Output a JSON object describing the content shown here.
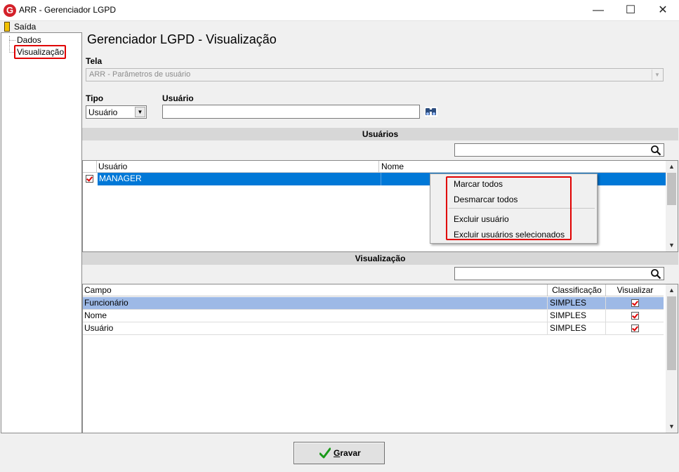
{
  "window": {
    "title": "ARR - Gerenciador LGPD",
    "app_icon_letter": "G",
    "min_glyph": "—",
    "max_glyph": "☐",
    "close_glyph": "✕"
  },
  "menubar": {
    "saida_label": "Saída"
  },
  "tree": {
    "items": [
      {
        "label": "Dados"
      },
      {
        "label": "Visualização",
        "highlighted": true
      }
    ]
  },
  "main": {
    "title": "Gerenciador LGPD - Visualização",
    "tela_label": "Tela",
    "tela_value": "ARR - Parâmetros de usuário",
    "tipo_label": "Tipo",
    "tipo_value": "Usuário",
    "usuario_label": "Usuário",
    "usuario_value": ""
  },
  "usuarios_section": {
    "title": "Usuários",
    "search_value": "",
    "columns": [
      "Usuário",
      "Nome"
    ],
    "rows": [
      {
        "checked": true,
        "usuario": "MANAGER",
        "nome": "",
        "selected": true
      }
    ]
  },
  "context_menu": {
    "items": [
      {
        "label": "Marcar todos"
      },
      {
        "label": "Desmarcar todos"
      },
      {
        "label": "Excluir usuário"
      },
      {
        "label": "Excluir usuários selecionados"
      }
    ]
  },
  "visualizacao_section": {
    "title": "Visualização",
    "search_value": "",
    "columns": [
      "Campo",
      "Classificação",
      "Visualizar"
    ],
    "rows": [
      {
        "campo": "Funcionário",
        "classificacao": "SIMPLES",
        "visualizar": true,
        "selected": true
      },
      {
        "campo": "Nome",
        "classificacao": "SIMPLES",
        "visualizar": true,
        "selected": false
      },
      {
        "campo": "Usuário",
        "classificacao": "SIMPLES",
        "visualizar": true,
        "selected": false
      }
    ]
  },
  "footer": {
    "gravar_label": "Gravar"
  },
  "colors": {
    "selection_blue": "#0078d7",
    "row_highlight": "#9db9e6",
    "highlight_red": "#e00000",
    "section_gray": "#d7d7d7"
  }
}
